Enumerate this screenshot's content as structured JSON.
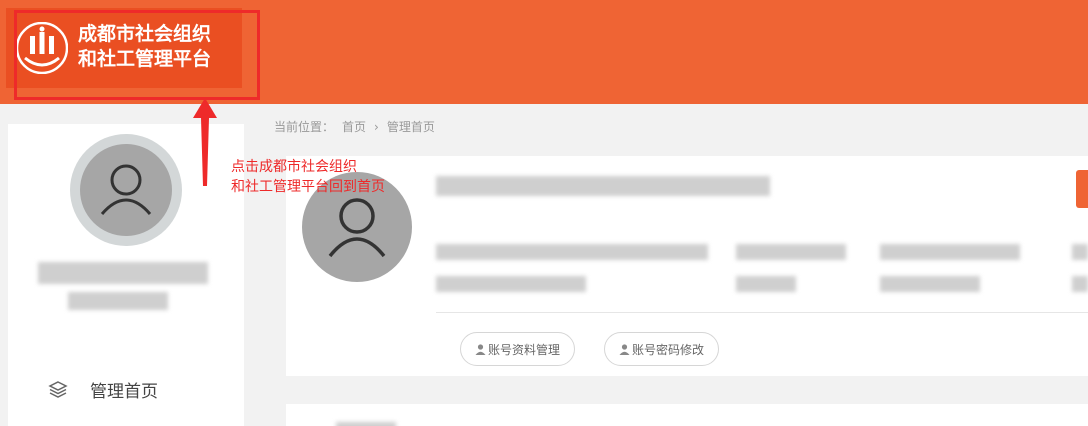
{
  "header": {
    "logo_line1": "成都市社会组织",
    "logo_line2": "和社工管理平台",
    "bg_color": "#ef6434",
    "logo_bg_color": "#ea4f22"
  },
  "sidebar": {
    "items": [
      {
        "label": "管理首页",
        "icon": "layers-icon"
      }
    ]
  },
  "breadcrumb": {
    "prefix": "当前位置：",
    "home": "首页",
    "separator": "›",
    "current": "管理首页"
  },
  "profile_card": {
    "buttons": [
      {
        "label": "账号资料管理",
        "icon": "user-icon"
      },
      {
        "label": "账号密码修改",
        "icon": "user-icon"
      }
    ]
  },
  "annotation": {
    "text": "点击成都市社会组织\n和社工管理平台回到首页",
    "color": "#ee2a2a"
  }
}
